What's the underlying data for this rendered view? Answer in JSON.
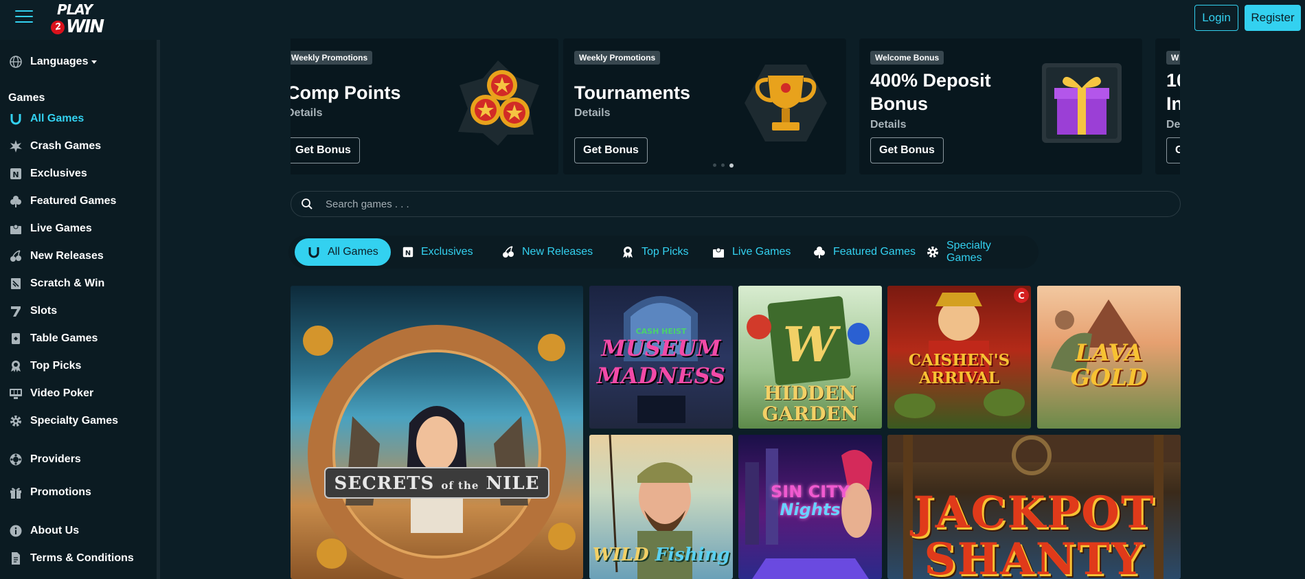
{
  "header": {
    "login_label": "Login",
    "register_label": "Register",
    "logo_text_top": "PLAY",
    "logo_text_num": "2",
    "logo_text_bottom": "WIN"
  },
  "sidebar": {
    "languages_label": "Languages",
    "games_heading": "Games",
    "items": [
      {
        "label": "All Games",
        "icon": "horseshoe-icon",
        "active": true
      },
      {
        "label": "Crash Games",
        "icon": "explosion-icon"
      },
      {
        "label": "Exclusives",
        "icon": "exclusive-badge-icon"
      },
      {
        "label": "Featured Games",
        "icon": "clover-icon"
      },
      {
        "label": "Live Games",
        "icon": "dealer-icon"
      },
      {
        "label": "New Releases",
        "icon": "cherries-icon"
      },
      {
        "label": "Scratch & Win",
        "icon": "scratch-card-icon"
      },
      {
        "label": "Slots",
        "icon": "seven-icon"
      },
      {
        "label": "Table Games",
        "icon": "card-icon"
      },
      {
        "label": "Top Picks",
        "icon": "award-icon"
      },
      {
        "label": "Video Poker",
        "icon": "poker-machine-icon"
      },
      {
        "label": "Specialty Games",
        "icon": "gear-icon"
      }
    ],
    "providers_label": "Providers",
    "promotions_label": "Promotions",
    "about_label": "About Us",
    "terms_label": "Terms & Conditions"
  },
  "promos": [
    {
      "tag": "Weekly Promotions",
      "title": "Comp Points",
      "details": "Details",
      "button": "Get Bonus",
      "art": "coins-icon"
    },
    {
      "tag": "Weekly Promotions",
      "title": "Tournaments",
      "details": "Details",
      "button": "Get Bonus",
      "art": "trophy-icon"
    },
    {
      "tag": "Welcome Bonus",
      "title": "400% Deposit Bonus",
      "details": "Details",
      "button": "Get Bonus",
      "art": "gift-box-icon"
    },
    {
      "tag": "W",
      "title": "10 In",
      "details": "De",
      "button": "G",
      "art": ""
    }
  ],
  "search": {
    "placeholder": "Search games . . ."
  },
  "tabs": [
    {
      "label": "All Games",
      "icon": "horseshoe-icon",
      "active": true
    },
    {
      "label": "Exclusives",
      "icon": "exclusive-badge-icon"
    },
    {
      "label": "New Releases",
      "icon": "cherries-icon"
    },
    {
      "label": "Top Picks",
      "icon": "award-icon"
    },
    {
      "label": "Live Games",
      "icon": "dealer-icon"
    },
    {
      "label": "Featured Games",
      "icon": "clover-icon"
    },
    {
      "label": "Specialty Games",
      "icon": "gear-icon"
    }
  ],
  "games": [
    {
      "name_a": "SECRETS",
      "name_b": "of the",
      "name_c": "NILE"
    },
    {
      "name_pre": "CASH HEIST",
      "name_a": "MUSEUM",
      "name_b": "MADNESS"
    },
    {
      "name_a": "HIDDEN",
      "name_b": "GARDEN"
    },
    {
      "name_a": "CAISHEN'S",
      "name_b": "ARRIVAL"
    },
    {
      "name_a": "LAVA",
      "name_b": "GOLD"
    },
    {
      "name_a": "WILD",
      "name_b": "Fishing"
    },
    {
      "name_a": "SIN CITY",
      "name_b": "Nights"
    },
    {
      "name_a": "JACKPOT",
      "name_b": "SHANTY"
    }
  ],
  "colors": {
    "accent": "#33d1f0",
    "bg": "#0c1e26",
    "sidebar": "#0b1b22"
  }
}
